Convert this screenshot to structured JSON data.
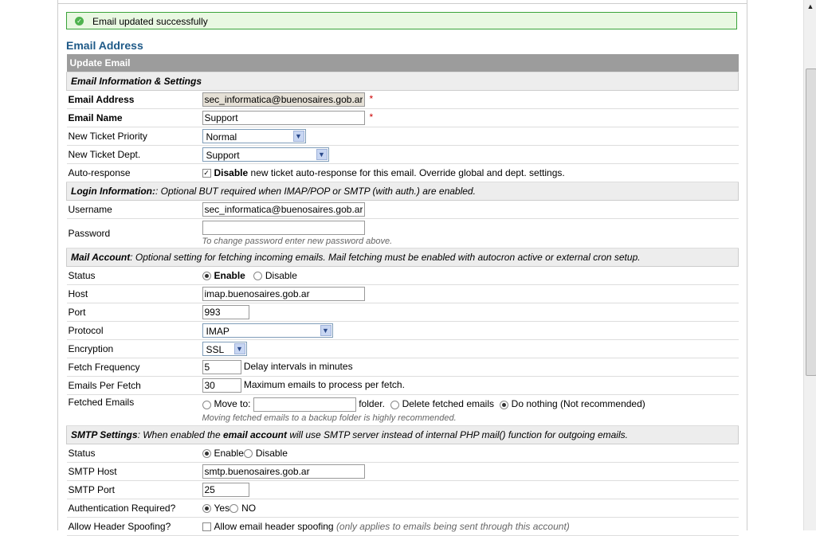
{
  "notice": {
    "message": "Email updated successfully"
  },
  "page_title": "Email Address",
  "form": {
    "header": "Update Email",
    "section_email": "Email Information & Settings",
    "email_address": {
      "label": "Email Address",
      "value": "sec_informatica@buenosaires.gob.ar"
    },
    "email_name": {
      "label": "Email Name",
      "value": "Support"
    },
    "priority": {
      "label": "New Ticket Priority",
      "value": "Normal"
    },
    "dept": {
      "label": "New Ticket Dept.",
      "value": "Support"
    },
    "autoresp": {
      "label": "Auto-response",
      "bold": "Disable",
      "text": "new ticket auto-response for this email. Override global and dept. settings.",
      "checked": true
    },
    "login_section": {
      "title": "Login Information:",
      "text": ": Optional BUT required when IMAP/POP or SMTP (with auth.) are enabled."
    },
    "username": {
      "label": "Username",
      "value": "sec_informatica@buenosaires.gob.ar"
    },
    "password": {
      "label": "Password",
      "value": "",
      "hint": "To change password enter new password above."
    },
    "mail_section": {
      "title": "Mail Account",
      "text": ": Optional setting for fetching incoming emails. Mail fetching must be enabled with autocron active or external cron setup."
    },
    "status": {
      "label": "Status",
      "enable": "Enable",
      "disable": "Disable",
      "selected": "Enable"
    },
    "host": {
      "label": "Host",
      "value": "imap.buenosaires.gob.ar"
    },
    "port": {
      "label": "Port",
      "value": "993"
    },
    "protocol": {
      "label": "Protocol",
      "value": "IMAP"
    },
    "encryption": {
      "label": "Encryption",
      "value": "SSL"
    },
    "fetch_freq": {
      "label": "Fetch Frequency",
      "value": "5",
      "suffix": "Delay intervals in minutes"
    },
    "per_fetch": {
      "label": "Emails Per Fetch",
      "value": "30",
      "suffix": "Maximum emails to process per fetch."
    },
    "fetched": {
      "label": "Fetched Emails",
      "move": "Move to:",
      "folder": "folder.",
      "delete": "Delete fetched emails",
      "nothing": "Do nothing (Not recommended)",
      "hint": "Moving fetched emails to a backup folder is highly recommended.",
      "folder_value": ""
    },
    "smtp_section": {
      "title": "SMTP Settings",
      "text1": ": When enabled the ",
      "bold": "email account",
      "text2": " will use SMTP server instead of internal PHP mail() function for outgoing emails."
    },
    "smtp_status": {
      "label": "Status",
      "enable": "Enable",
      "disable": "Disable"
    },
    "smtp_host": {
      "label": "SMTP Host",
      "value": "smtp.buenosaires.gob.ar"
    },
    "smtp_port": {
      "label": "SMTP Port",
      "value": "25"
    },
    "auth": {
      "label": "Authentication Required?",
      "yes": "Yes",
      "no": "NO"
    },
    "spoof": {
      "label": "Allow Header Spoofing?",
      "text": "Allow email header spoofing",
      "hint": "(only applies to emails being sent through this account)"
    }
  },
  "colors": {
    "header_bg": "#9c9c9c",
    "section_bg": "#ededed",
    "title": "#1f5a88",
    "notice_bg": "#e9f8e2"
  }
}
